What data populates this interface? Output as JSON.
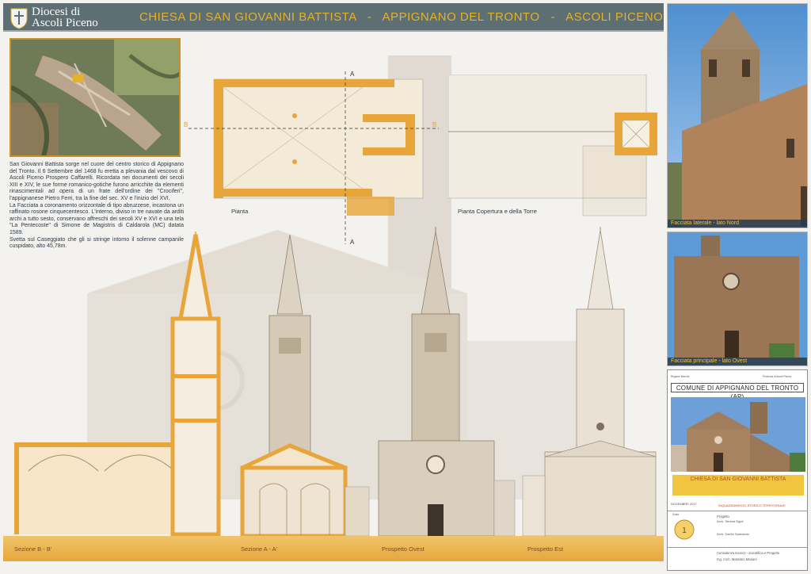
{
  "header": {
    "logo_line1": "Diocesi di",
    "logo_line2": "Ascoli Piceno",
    "title": "CHIESA DI SAN GIOVANNI BATTISTA   -   APPIGNANO DEL TRONTO   -   ASCOLI PICENO"
  },
  "description": [
    "San Giovanni Battista sorge nel cuore del centro storico di Appignano del Tronto. Il 6 Settembre del 1468 fu eretta a plevania dal vescovo di Ascoli Piceno Prospero Caffarelli. Ricordata nei documenti dei secoli XIII e XIV, le sue forme romanico-gotiche furono arricchite da elementi rinascimentali ad opera di un frate dell'ordine dei \"Crociferi\", l'appignanese Pietro Ferri, tra la fine del sec. XV e l'inizio del XVI.",
    "La Facciata a coronamento orizzontale di tipo abruzzese, incastona un raffinato rosone cinquecentesco. L'interno, diviso in tre navate da arditi archi a tutto sesto, conservano affreschi dei secoli XV e XVI e una tela \"La Pentecoste\" di Simone de Magistris di Caldarola (MC) datata 1589.",
    "Svetta sul Caseggiato che gli si stringe intorno il solenne campanile cuspidato, alto 45,78m."
  ],
  "plans": {
    "plan_caption": "Pianta",
    "roof_caption": "Pianta Copertura e della Torre",
    "marker_a": "A",
    "marker_b": "B"
  },
  "elevations": {
    "section_bb": "Sezione B - B'",
    "section_aa": "Sezione A - A'",
    "prospetto_ovest": "Prospetto Ovest",
    "prospetto_est": "Prospetto Est"
  },
  "photos": {
    "north_caption": "Facciata laterale - lato Nord",
    "west_caption": "Facciata principale - lato Ovest"
  },
  "cartouche": {
    "regione": "Regione Marche",
    "provincia": "Provincia di Ascoli Piceno",
    "comune": "COMUNE DI APPIGNANO DEL TRONTO (AP)",
    "chiesa": "CHIESA DI SAN GIOVANNI BATTISTA",
    "data": "NOVEMBRE 2017",
    "elaborato": "INQUADRAMENTO STORICO TERRITORIALE",
    "progetto": "Progetto",
    "arch1": "Arch. Serena Egidi",
    "arch2": "Arch. Danilo Sparasoio",
    "consulenza": "Consulenza tecnico - scientifica e Progetto",
    "ing": "Ing. Arch. Massimo Mariani",
    "scala": "Scala",
    "tav": "1"
  },
  "colors": {
    "header": "#5d6f73",
    "accent_gold": "#e4b12c",
    "orange_section": "#e8a53a",
    "caption_blue": "#243c52"
  }
}
